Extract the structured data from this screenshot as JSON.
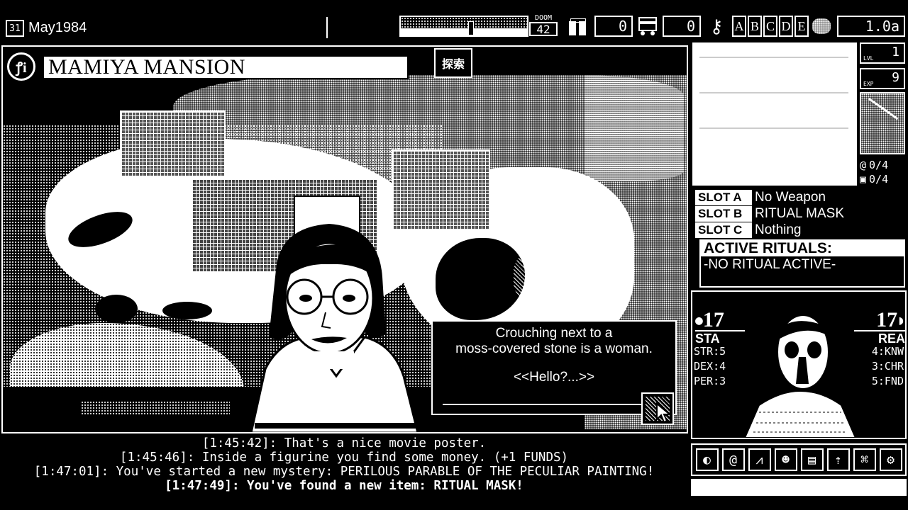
{
  "date": {
    "day_icon": "31",
    "text": "May1984"
  },
  "doom": {
    "label": "DOOM",
    "value": "42"
  },
  "funds": {
    "icon": "funds-icon",
    "value": "0"
  },
  "enemies": {
    "icon": "bus-icon",
    "value": "0"
  },
  "keys": {
    "icon": "key-icon",
    "letters": [
      "A",
      "B",
      "C",
      "D",
      "E"
    ]
  },
  "version": "1.0a",
  "location": {
    "title": "MAMIYA MANSION",
    "badge": "探索"
  },
  "dialogue": {
    "line1": "Crouching next to a",
    "line2": "moss-covered stone is a woman.",
    "choice": "<<Hello?...>>"
  },
  "level": {
    "lvl_label": "LVL",
    "lvl": "1",
    "exp_label": "EXP",
    "exp": "9"
  },
  "counters": {
    "spiral": "0/4",
    "lock": "0/4"
  },
  "slots": [
    {
      "label": "SLOT A",
      "value": "No Weapon"
    },
    {
      "label": "SLOT B",
      "value": "RITUAL MASK"
    },
    {
      "label": "SLOT C",
      "value": "Nothing"
    }
  ],
  "rituals": {
    "title": "ACTIVE RITUALS:",
    "value": "-NO RITUAL ACTIVE-"
  },
  "stats": {
    "sta_value": "17",
    "sta_label": "STA",
    "rea_value": "17",
    "rea_label": "REA",
    "str": "STR:5",
    "dex": "DEX:4",
    "per": "PER:3",
    "knw": "4:KNW",
    "chr": "3:CHR",
    "fnd": "5:FND"
  },
  "log": [
    "[1:45:42]: That's a nice movie poster.",
    "[1:45:46]: Inside a figurine you find some money. (+1 FUNDS)",
    "[1:47:01]: You've started a new mystery: PERILOUS PARABLE OF THE PECULIAR PAINTING!",
    "[1:47:49]: You've found a new item: RITUAL MASK!"
  ],
  "toolbar": [
    "brain-icon",
    "spiral-icon",
    "chart-icon",
    "people-icon",
    "book-icon",
    "level-up-icon",
    "map-icon",
    "gear-icon"
  ],
  "colors": {
    "fg": "#ffffff",
    "bg": "#000000"
  }
}
